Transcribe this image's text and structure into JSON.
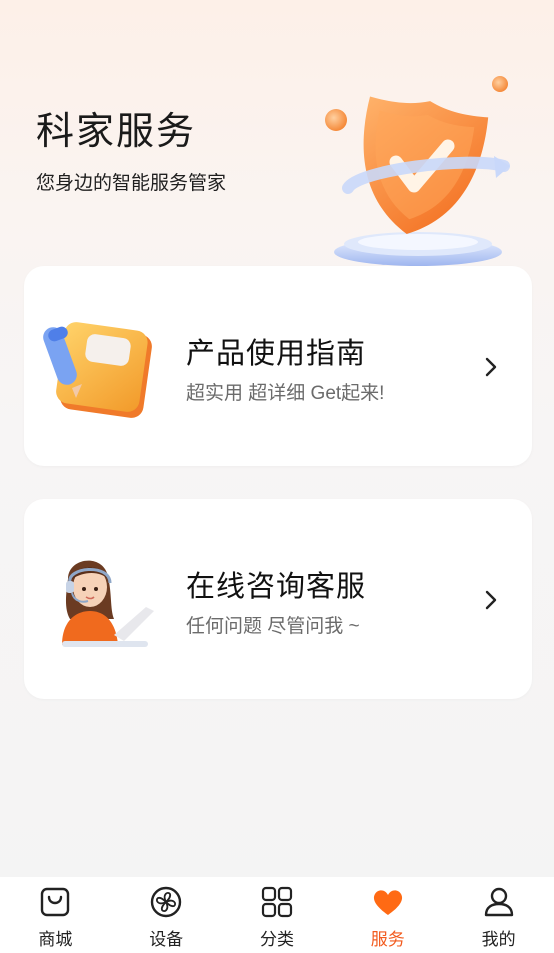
{
  "header": {
    "title": "科家服务",
    "subtitle": "您身边的智能服务管家"
  },
  "cards": [
    {
      "title": "产品使用指南",
      "subtitle": "超实用 超详细 Get起来!",
      "icon": "guide-book-icon"
    },
    {
      "title": "在线咨询客服",
      "subtitle": "任何问题 尽管问我 ~",
      "icon": "customer-service-agent-icon"
    }
  ],
  "tabbar": {
    "items": [
      {
        "label": "商城",
        "icon": "shopping-bag-icon",
        "active": false
      },
      {
        "label": "设备",
        "icon": "fan-device-icon",
        "active": false
      },
      {
        "label": "分类",
        "icon": "grid-icon",
        "active": false
      },
      {
        "label": "服务",
        "icon": "heart-icon",
        "active": true
      },
      {
        "label": "我的",
        "icon": "user-icon",
        "active": false
      }
    ]
  },
  "colors": {
    "accent": "#f25a1d",
    "heart": "#ff6a14",
    "card_bg": "#ffffff"
  }
}
